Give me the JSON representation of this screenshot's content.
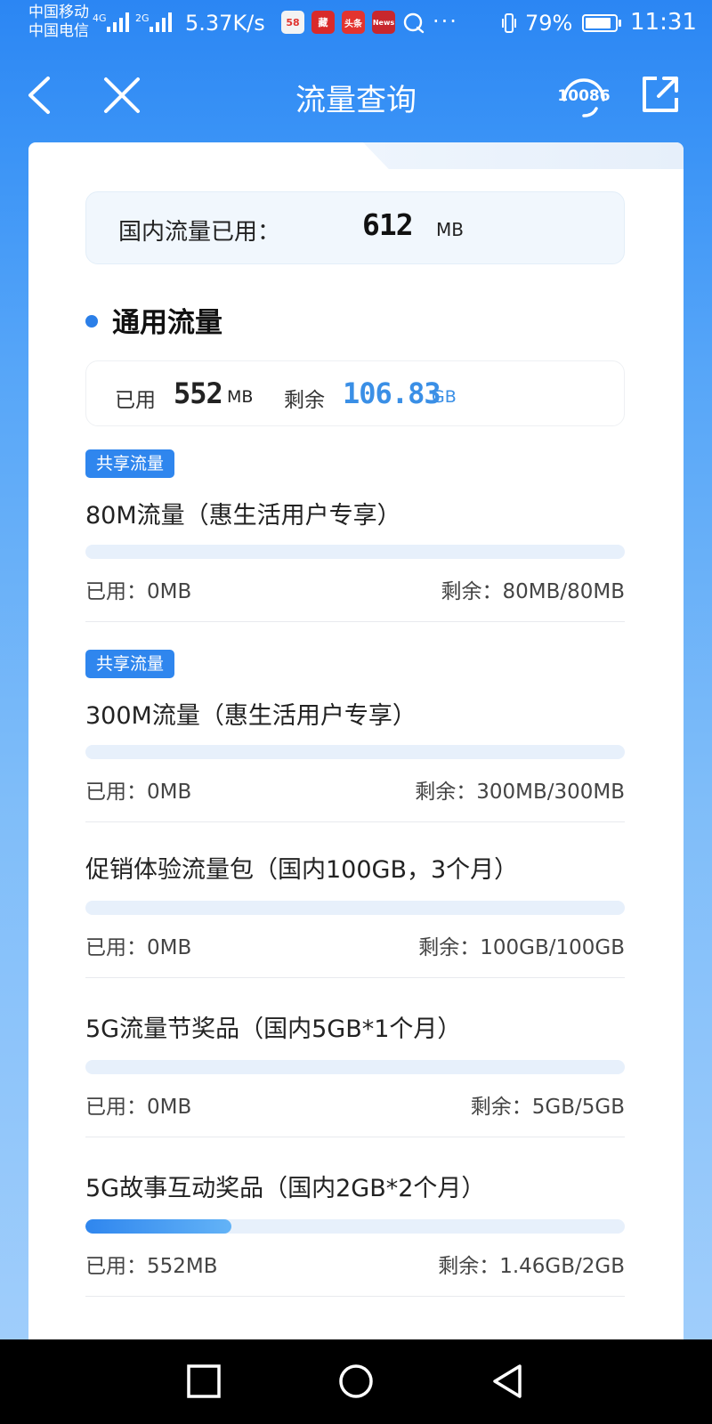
{
  "status_bar": {
    "carrier_1": "中国移动",
    "carrier_2": "中国电信",
    "net_1": "4G",
    "net_2": "2G",
    "net_speed": "5.37K/s",
    "app_icons": [
      "58",
      "藏",
      "头条",
      "News"
    ],
    "more": "···",
    "battery_pct": "79%",
    "time": "11:31"
  },
  "nav": {
    "title": "流量查询",
    "service_number": "10086"
  },
  "domestic": {
    "label": "国内流量已用：",
    "value": "612",
    "unit": "MB"
  },
  "general": {
    "title": "通用流量",
    "used_label": "已用",
    "used_value": "552",
    "used_unit": "MB",
    "remain_label": "剩余",
    "remain_value": "106.83",
    "remain_unit": "GB"
  },
  "packages": [
    {
      "badge": "共享流量",
      "name": "80M流量（惠生活用户专享）",
      "used": "已用：0MB",
      "remain": "剩余：80MB/80MB",
      "progress": 0
    },
    {
      "badge": "共享流量",
      "name": "300M流量（惠生活用户专享）",
      "used": "已用：0MB",
      "remain": "剩余：300MB/300MB",
      "progress": 0
    },
    {
      "badge": "",
      "name": "促销体验流量包（国内100GB，3个月）",
      "used": "已用：0MB",
      "remain": "剩余：100GB/100GB",
      "progress": 0
    },
    {
      "badge": "",
      "name": "5G流量节奖品（国内5GB*1个月）",
      "used": "已用：0MB",
      "remain": "剩余：5GB/5GB",
      "progress": 0
    },
    {
      "badge": "",
      "name": "5G故事互动奖品（国内2GB*2个月）",
      "used": "已用：552MB",
      "remain": "剩余：1.46GB/2GB",
      "progress": 0.27
    }
  ],
  "colors": {
    "brand_blue": "#2f86ee",
    "accent_value": "#3a8fe6",
    "track": "#e7f0fb"
  }
}
